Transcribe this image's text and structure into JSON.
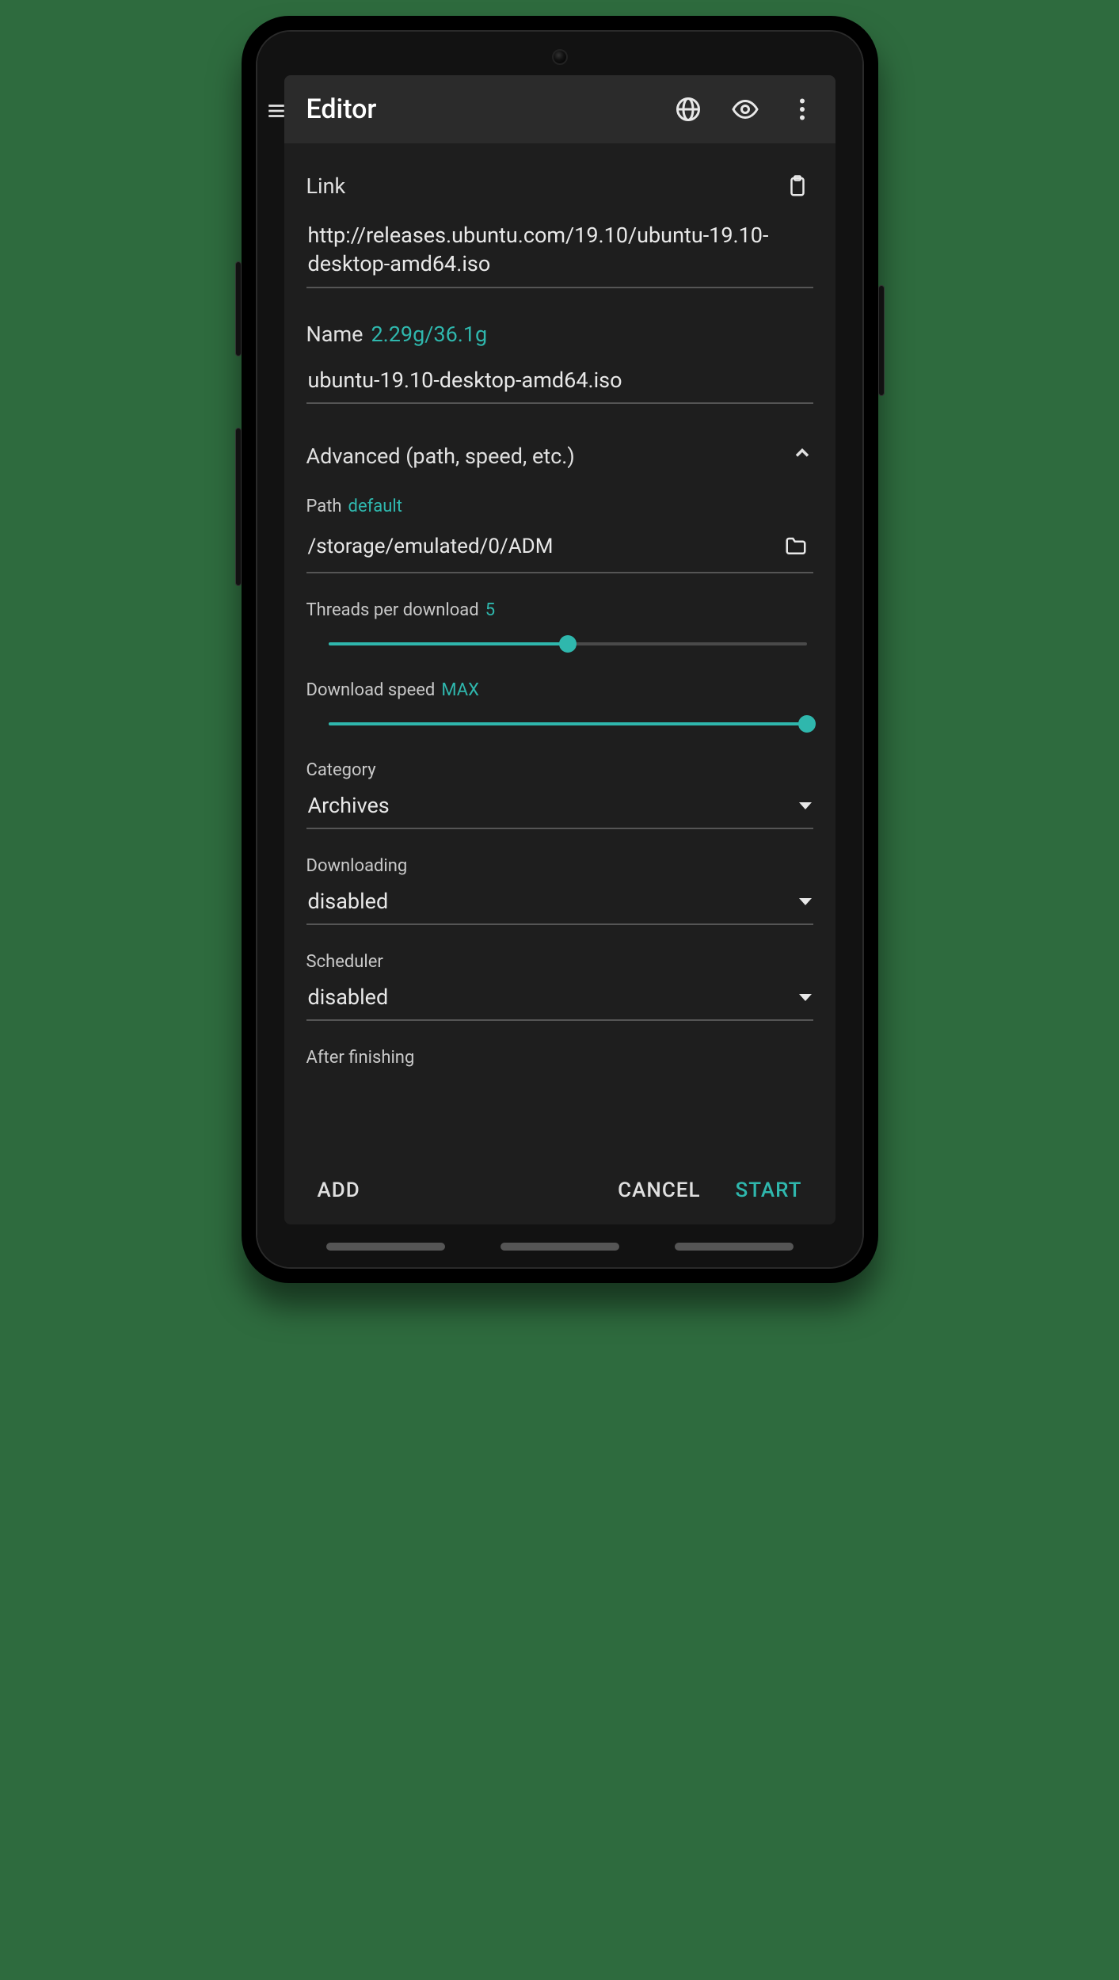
{
  "dialog": {
    "title": "Editor",
    "link": {
      "label": "Link",
      "value": "http://releases.ubuntu.com/19.10/ubuntu-19.10-desktop-amd64.iso"
    },
    "name": {
      "label": "Name",
      "hint": "2.29g/36.1g",
      "value": "ubuntu-19.10-desktop-amd64.iso"
    },
    "advanced": {
      "label": "Advanced (path, speed, etc.)",
      "path": {
        "label": "Path",
        "hint": "default",
        "value": "/storage/emulated/0/ADM"
      },
      "threads": {
        "label": "Threads per download",
        "value": "5",
        "percent": 50
      },
      "speed": {
        "label": "Download speed",
        "value": "MAX",
        "percent": 100
      },
      "category": {
        "label": "Category",
        "value": "Archives"
      },
      "downloading": {
        "label": "Downloading",
        "value": "disabled"
      },
      "scheduler": {
        "label": "Scheduler",
        "value": "disabled"
      },
      "after_finishing": {
        "label": "After finishing"
      }
    },
    "buttons": {
      "add": "ADD",
      "cancel": "CANCEL",
      "start": "START"
    }
  },
  "colors": {
    "accent": "#2fb7ad"
  }
}
